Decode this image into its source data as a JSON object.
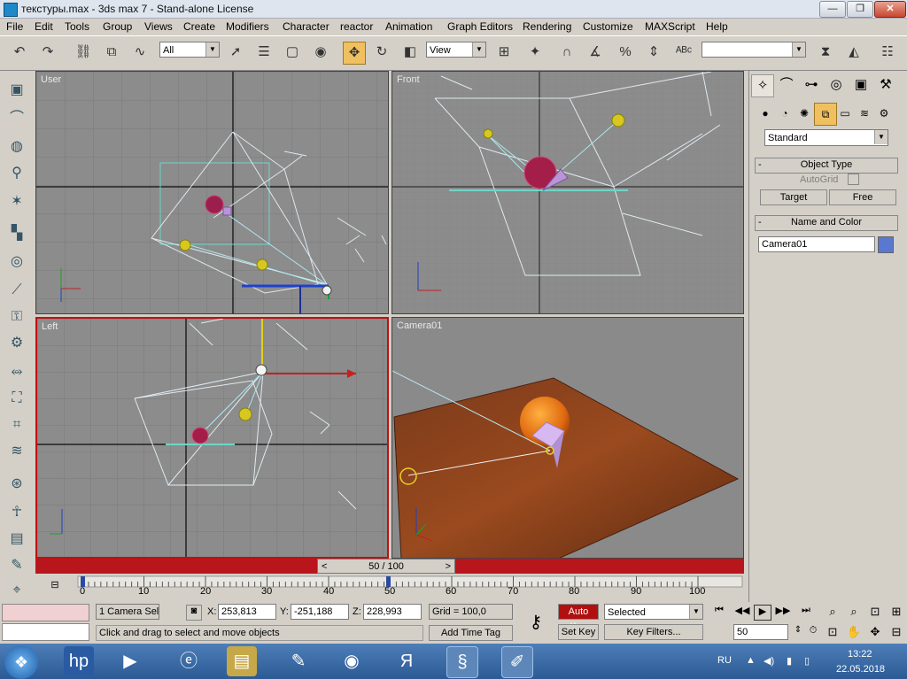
{
  "window": {
    "title": "текстуры.max - 3ds max 7   - Stand-alone License",
    "minimize": "—",
    "maximize": "❐",
    "close": "✕"
  },
  "menu": [
    "File",
    "Edit",
    "Tools",
    "Group",
    "Views",
    "Create",
    "Modifiers",
    "Character",
    "reactor",
    "Animation",
    "Graph Editors",
    "Rendering",
    "Customize",
    "MAXScript",
    "Help"
  ],
  "toolbar": {
    "selection_filter": "All",
    "reference_coord": "View",
    "named_selection": ""
  },
  "viewports": {
    "top_left": "User",
    "top_right": "Front",
    "bottom_left": "Left",
    "bottom_right": "Camera01"
  },
  "command_panel": {
    "category": "Standard",
    "object_type_header": "Object Type",
    "autogrid": "AutoGrid",
    "target_button": "Target",
    "free_button": "Free",
    "name_color_header": "Name and Color",
    "name_value": "Camera01",
    "object_color": "#5a78d2"
  },
  "time_slider": {
    "label": "50 / 100",
    "prev": "<",
    "next": ">"
  },
  "trackbar": {
    "ticks": [
      "0",
      "10",
      "20",
      "30",
      "40",
      "50",
      "60",
      "70",
      "80",
      "90",
      "100"
    ]
  },
  "status": {
    "selection": "1 Camera Sel",
    "x_label": "X:",
    "x_value": "253,813",
    "y_label": "Y:",
    "y_value": "-251,188",
    "z_label": "Z:",
    "z_value": "228,993",
    "grid": "Grid = 100,0",
    "prompt": "Click and drag to select and move objects",
    "add_time_tag": "Add Time Tag",
    "auto_key": "Auto Key",
    "set_key": "Set Key",
    "key_mode": "Selected",
    "key_filters": "Key Filters...",
    "frame": "50"
  },
  "taskbar": {
    "lang": "RU",
    "time": "13:22",
    "date": "22.05.2018"
  },
  "colors": {
    "active_viewport": "#c01010",
    "time_slider": "#b8161c",
    "auto_key_bg": "#b01010"
  }
}
